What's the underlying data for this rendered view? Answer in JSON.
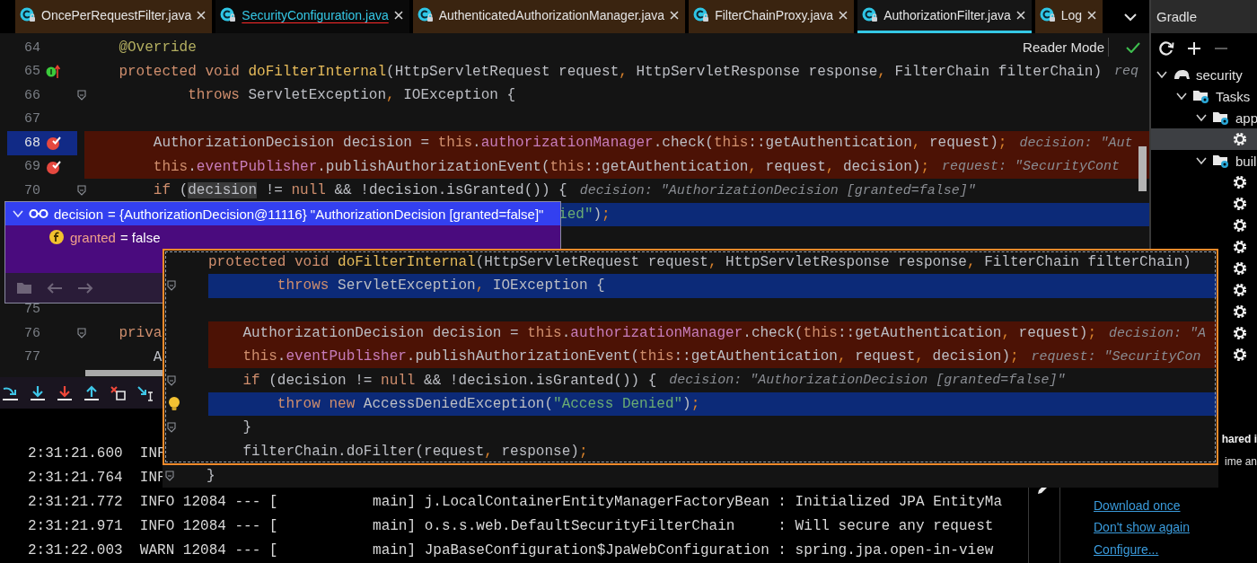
{
  "tabs": [
    {
      "label": "OncePerRequestFilter.java",
      "selected": false,
      "error": false
    },
    {
      "label": "SecurityConfiguration.java",
      "selected": false,
      "error": true
    },
    {
      "label": "AuthenticatedAuthorizationManager.java",
      "selected": false,
      "error": false
    },
    {
      "label": "FilterChainProxy.java",
      "selected": false,
      "error": false
    },
    {
      "label": "AuthorizationFilter.java",
      "selected": true,
      "error": false
    },
    {
      "label": "Log",
      "selected": false,
      "error": false
    }
  ],
  "editor": {
    "reader_mode": "Reader Mode",
    "blocks": [
      {
        "lines": [
          {
            "num": "64",
            "tokens": [
              {
                "kind": "annotation",
                "text": "    @Override"
              }
            ]
          },
          {
            "num": "65",
            "override": true,
            "tokens": [
              {
                "kind": "keyword",
                "text": "    protected void "
              },
              {
                "kind": "method",
                "text": "doFilterInternal"
              },
              {
                "kind": "plain",
                "text": "(HttpServletRequest request"
              },
              {
                "kind": "punct",
                "text": ", "
              },
              {
                "kind": "plain",
                "text": "HttpServletResponse response"
              },
              {
                "kind": "punct",
                "text": ", "
              },
              {
                "kind": "plain",
                "text": "FilterChain filterChain)"
              }
            ],
            "hint": "req"
          },
          {
            "num": "66",
            "foldable": true,
            "tokens": [
              {
                "kind": "keyword",
                "text": "            throws "
              },
              {
                "kind": "plain",
                "text": "ServletException"
              },
              {
                "kind": "punct",
                "text": ", "
              },
              {
                "kind": "plain",
                "text": "IOException {"
              }
            ]
          },
          {
            "num": "67"
          },
          {
            "num": "68",
            "current": true,
            "breakpoint": true,
            "tokens": [
              {
                "kind": "plain",
                "text": "        AuthorizationDecision decision = "
              },
              {
                "kind": "keyword",
                "text": "this"
              },
              {
                "kind": "plain",
                "text": "."
              },
              {
                "kind": "field",
                "text": "authorizationManager"
              },
              {
                "kind": "plain",
                "text": ".check("
              },
              {
                "kind": "keyword",
                "text": "this"
              },
              {
                "kind": "plain",
                "text": "::getAuthentication"
              },
              {
                "kind": "punct",
                "text": ", "
              },
              {
                "kind": "plain",
                "text": "request)"
              },
              {
                "kind": "punct",
                "text": ";"
              }
            ],
            "hint": "decision: \"Aut"
          },
          {
            "num": "69",
            "breakpoint": true,
            "tokens": [
              {
                "kind": "keyword",
                "text": "        this"
              },
              {
                "kind": "plain",
                "text": "."
              },
              {
                "kind": "field",
                "text": "eventPublisher"
              },
              {
                "kind": "plain",
                "text": ".publishAuthorizationEvent("
              },
              {
                "kind": "keyword",
                "text": "this"
              },
              {
                "kind": "plain",
                "text": "::getAuthentication"
              },
              {
                "kind": "punct",
                "text": ", "
              },
              {
                "kind": "plain",
                "text": "request"
              },
              {
                "kind": "punct",
                "text": ", "
              },
              {
                "kind": "plain",
                "text": "decision)"
              },
              {
                "kind": "punct",
                "text": ";"
              }
            ],
            "hint": "request: \"SecurityCont"
          },
          {
            "num": "70",
            "foldable": true,
            "tokens": [
              {
                "kind": "keyword",
                "text": "        if "
              },
              {
                "kind": "plain",
                "text": "("
              },
              {
                "kind": "usage",
                "text": "decision"
              },
              {
                "kind": "plain",
                "text": " != "
              },
              {
                "kind": "keyword",
                "text": "null "
              },
              {
                "kind": "plain",
                "text": "&& !decision.isGranted()) {"
              }
            ],
            "hint": "decision: \"AuthorizationDecision [granted=false]\""
          },
          {
            "execution": true,
            "tokens": [
              {
                "kind": "string",
                "text": "                                                       ied\""
              },
              {
                "kind": "plain",
                "text": ")"
              },
              {
                "kind": "punct",
                "text": ";"
              }
            ]
          }
        ]
      },
      {
        "lines": [
          {
            "num": "75"
          },
          {
            "num": "76",
            "foldable": true,
            "tokens": [
              {
                "kind": "keyword",
                "text": "    priva"
              }
            ]
          },
          {
            "num": "77",
            "tokens": [
              {
                "kind": "plain",
                "text": "        A"
              }
            ]
          }
        ]
      }
    ]
  },
  "debug_popup": {
    "nodes": [
      {
        "name": "decision",
        "value": "= {AuthorizationDecision@11116} \"AuthorizationDecision [granted=false]\"",
        "expanded": true,
        "selected": true,
        "children": [
          {
            "name": "granted",
            "value": "= false",
            "selected": false
          }
        ]
      }
    ]
  },
  "code_preview": {
    "framed_blocks": [
      {
        "lines": [
          {
            "tokens": [
              {
                "kind": "keyword",
                "text": "protected void "
              },
              {
                "kind": "method",
                "text": "doFilterInternal"
              },
              {
                "kind": "plain",
                "text": "(HttpServletRequest request"
              },
              {
                "kind": "punct",
                "text": ", "
              },
              {
                "kind": "plain",
                "text": "HttpServletResponse response"
              },
              {
                "kind": "punct",
                "text": ", "
              },
              {
                "kind": "plain",
                "text": "FilterChain filterChain)"
              }
            ]
          },
          {
            "execution": true,
            "foldable": true,
            "tokens": [
              {
                "kind": "keyword",
                "text": "        throws "
              },
              {
                "kind": "plain",
                "text": "ServletException"
              },
              {
                "kind": "punct",
                "text": ", "
              },
              {
                "kind": "plain",
                "text": "IOException {"
              }
            ]
          }
        ]
      },
      {
        "lines": [
          {
            "breakpoint": true,
            "tokens": [
              {
                "kind": "plain",
                "text": "    AuthorizationDecision decision = "
              },
              {
                "kind": "keyword",
                "text": "this"
              },
              {
                "kind": "plain",
                "text": "."
              },
              {
                "kind": "field",
                "text": "authorizationManager"
              },
              {
                "kind": "plain",
                "text": ".check("
              },
              {
                "kind": "keyword",
                "text": "this"
              },
              {
                "kind": "plain",
                "text": "::getAuthentication"
              },
              {
                "kind": "punct",
                "text": ", "
              },
              {
                "kind": "plain",
                "text": "request)"
              },
              {
                "kind": "punct",
                "text": ";"
              }
            ],
            "hint": "decision: \"A"
          },
          {
            "breakpoint": true,
            "tokens": [
              {
                "kind": "keyword",
                "text": "    this"
              },
              {
                "kind": "plain",
                "text": "."
              },
              {
                "kind": "field",
                "text": "eventPublisher"
              },
              {
                "kind": "plain",
                "text": ".publishAuthorizationEvent("
              },
              {
                "kind": "keyword",
                "text": "this"
              },
              {
                "kind": "plain",
                "text": "::getAuthentication"
              },
              {
                "kind": "punct",
                "text": ", "
              },
              {
                "kind": "plain",
                "text": "request"
              },
              {
                "kind": "punct",
                "text": ", "
              },
              {
                "kind": "plain",
                "text": "decision)"
              },
              {
                "kind": "punct",
                "text": ";"
              }
            ],
            "hint": "request: \"SecurityCon"
          },
          {
            "foldable": true,
            "tokens": [
              {
                "kind": "keyword",
                "text": "    if "
              },
              {
                "kind": "plain",
                "text": "(decision != "
              },
              {
                "kind": "keyword",
                "text": "null "
              },
              {
                "kind": "plain",
                "text": "&& !decision.isGranted()) {"
              }
            ],
            "hint": "decision: \"AuthorizationDecision [granted=false]\""
          },
          {
            "execution": true,
            "intention": true,
            "tokens": [
              {
                "kind": "keyword",
                "text": "        throw new "
              },
              {
                "kind": "plain",
                "text": "AccessDeniedException("
              },
              {
                "kind": "string",
                "text": "\"Access Denied\""
              },
              {
                "kind": "plain",
                "text": ")"
              },
              {
                "kind": "punct",
                "text": ";"
              }
            ]
          },
          {
            "foldable": true,
            "tokens": [
              {
                "kind": "plain",
                "text": "    }"
              }
            ]
          },
          {
            "tokens": [
              {
                "kind": "plain",
                "text": "    filterChain.doFilter(request"
              },
              {
                "kind": "punct",
                "text": ", "
              },
              {
                "kind": "plain",
                "text": "response)"
              },
              {
                "kind": "punct",
                "text": ";"
              }
            ]
          }
        ]
      }
    ],
    "lines_below": [
      {
        "foldable": true,
        "tokens": [
          {
            "kind": "plain",
            "text": "}"
          }
        ]
      }
    ]
  },
  "gradle": {
    "title": "Gradle",
    "tree": [
      {
        "label": "security",
        "kind": "project",
        "expanded": true,
        "selected": false,
        "children": [
          {
            "label": "Tasks",
            "kind": "folder",
            "expanded": true,
            "selected": false,
            "children": [
              {
                "label": "app",
                "kind": "folder",
                "expanded": true,
                "selected": false,
                "children": [
                  {
                    "kind": "task",
                    "selected": true
                  }
                ]
              },
              {
                "label": "buil",
                "kind": "folder",
                "expanded": true,
                "selected": false,
                "children": [
                  {
                    "kind": "task",
                    "selected": false
                  },
                  {
                    "kind": "task",
                    "selected": false
                  },
                  {
                    "kind": "task",
                    "selected": false
                  },
                  {
                    "kind": "task",
                    "selected": false
                  },
                  {
                    "kind": "task",
                    "selected": false
                  },
                  {
                    "kind": "task",
                    "selected": false
                  },
                  {
                    "kind": "task",
                    "selected": false
                  },
                  {
                    "kind": "task",
                    "selected": false
                  },
                  {
                    "kind": "task",
                    "selected": false
                  }
                ]
              }
            ]
          }
        ]
      }
    ]
  },
  "console": {
    "log_lines": [
      "2:31:21.600  INF",
      "2:31:21.764  INF",
      "2:31:21.772  INFO 12084 --- [           main] j.LocalContainerEntityManagerFactoryBean : Initialized JPA EntityMa",
      "2:31:21.971  INFO 12084 --- [           main] o.s.s.web.DefaultSecurityFilterChain     : Will secure any request",
      "2:31:22.003  WARN 12084 --- [           main] JpaBaseConfiguration$JpaWebConfiguration : spring.jpa.open-in-view"
    ]
  },
  "notification": {
    "title": "hared i",
    "body": "ime an",
    "links": [
      "Download once",
      "Don't show again",
      "Configure..."
    ]
  }
}
